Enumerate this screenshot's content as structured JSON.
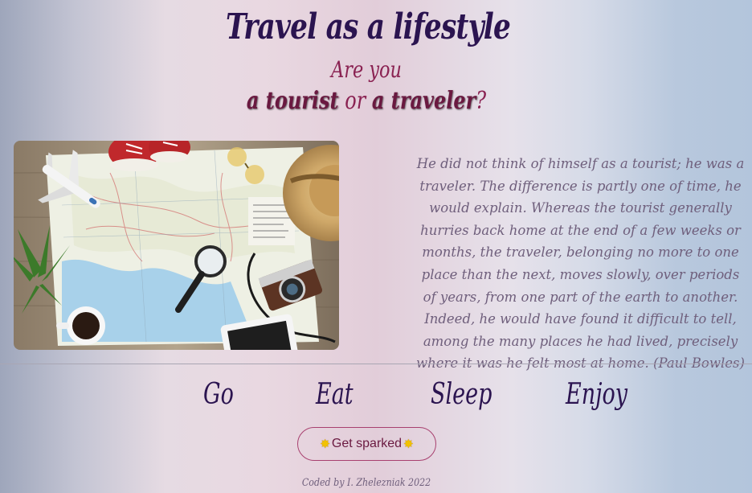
{
  "header": {
    "title": "Travel as a lifestyle",
    "subtitle": "Are you",
    "question": {
      "part1": "a tourist",
      "connector": " or ",
      "part2": "a traveler",
      "end": "?"
    }
  },
  "quote": {
    "text": "He did not think of himself as a tourist; he was a traveler. The difference is partly one of time, he would explain. Whereas the tourist generally hurries back home at the end of a few weeks or months, the traveler, belonging no more to one place than the next, moves slowly, over periods of years, from one part of the earth to another. Indeed, he would have found it difficult to tell, among the many places he had lived, precisely where it was he felt most at home. (Paul Bowles)"
  },
  "nav": {
    "go": "Go",
    "eat": "Eat",
    "sleep": "Sleep",
    "enjoy": "Enjoy"
  },
  "cta": {
    "label": "Get sparked",
    "icon": "sparkle-icon"
  },
  "footer": {
    "credit": "Coded by I. Zhelezniak 2022"
  },
  "colors": {
    "title": "#2b1450",
    "accent": "#8a2252",
    "quote": "#6f5f7c"
  }
}
